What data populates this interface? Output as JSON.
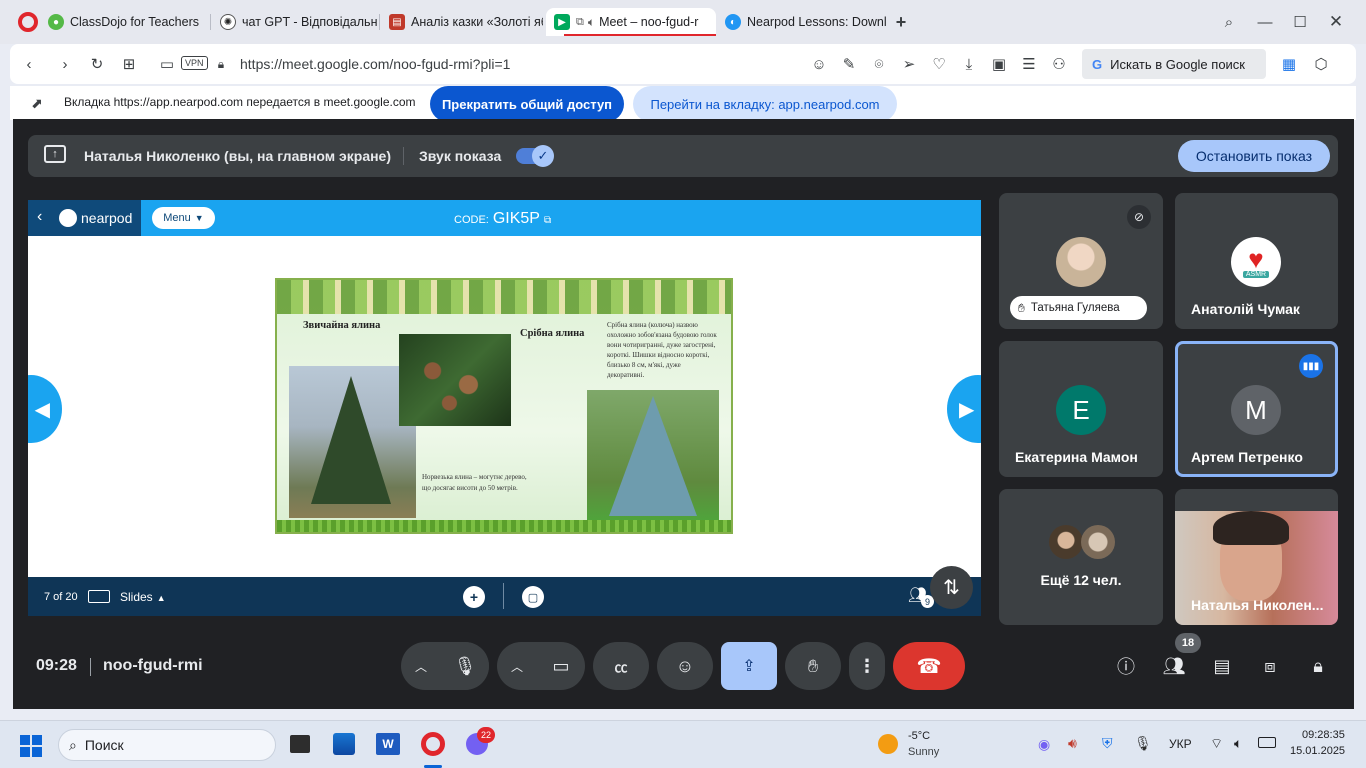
{
  "browser": {
    "tabs": [
      {
        "label": "ClassDojo for Teachers"
      },
      {
        "label": "чат GPT - Відповідальніст"
      },
      {
        "label": "Аналіз казки «Золоті ябл"
      },
      {
        "label": "Meet – noo-fgud-r"
      },
      {
        "label": "Nearpod Lessons: Downlo"
      }
    ],
    "new_tab": "+",
    "url": "https://meet.google.com/noo-fgud-rmi?pli=1",
    "vpn_label": "VPN",
    "search_box": "Искать в Google поиск"
  },
  "infobar": {
    "message": "Вкладка https://app.nearpod.com передается в meet.google.com",
    "stop_button": "Прекратить общий доступ",
    "goto_button": "Перейти на вкладку: app.nearpod.com"
  },
  "share": {
    "presenter": "Наталья Николенко (вы, на главном экране)",
    "sound_label": "Звук показа",
    "sound_on": true,
    "stop_button": "Остановить показ"
  },
  "nearpod": {
    "logo": "nearpod",
    "menu": "Menu",
    "code_label": "CODE:",
    "code": "GIK5P",
    "slide": {
      "title_left": "Звичайна ялина",
      "title_right": "Срібна ялина",
      "text_right": "Срібна ялина (колюча) назвою охоложно зобов'язана будовою голок вони чотиригранні, дуже загострені, короткі. Шишки відносно короткі, близько 8 см, м'які, дуже декоративні.",
      "text_bottom": "Норвезька ялина – могутнє дерево, що досягає висоти до 50 метрів."
    },
    "counter": "7 of 20",
    "slides_label": "Slides",
    "participants_badge": "9"
  },
  "participants": [
    {
      "name": "Татьяна Гуляева",
      "muted": true
    },
    {
      "name": "Анатолій Чумак",
      "badge_text": "ASMR"
    },
    {
      "name": "Екатерина Мамон",
      "initial": "E",
      "color": "#00796b"
    },
    {
      "name": "Артем Петренко",
      "initial": "M",
      "color": "#5f6368",
      "speaking": true
    },
    {
      "name": "Ещё 12 чел."
    },
    {
      "name": "Наталья Николен..."
    }
  ],
  "meeting": {
    "time": "09:28",
    "code": "noo-fgud-rmi",
    "people_count": "18"
  },
  "taskbar": {
    "search_placeholder": "Поиск",
    "weather_temp": "-5°C",
    "weather_desc": "Sunny",
    "lang": "УКР",
    "clock_time": "09:28:35",
    "clock_date": "15.01.2025",
    "viber_badge": "22"
  }
}
